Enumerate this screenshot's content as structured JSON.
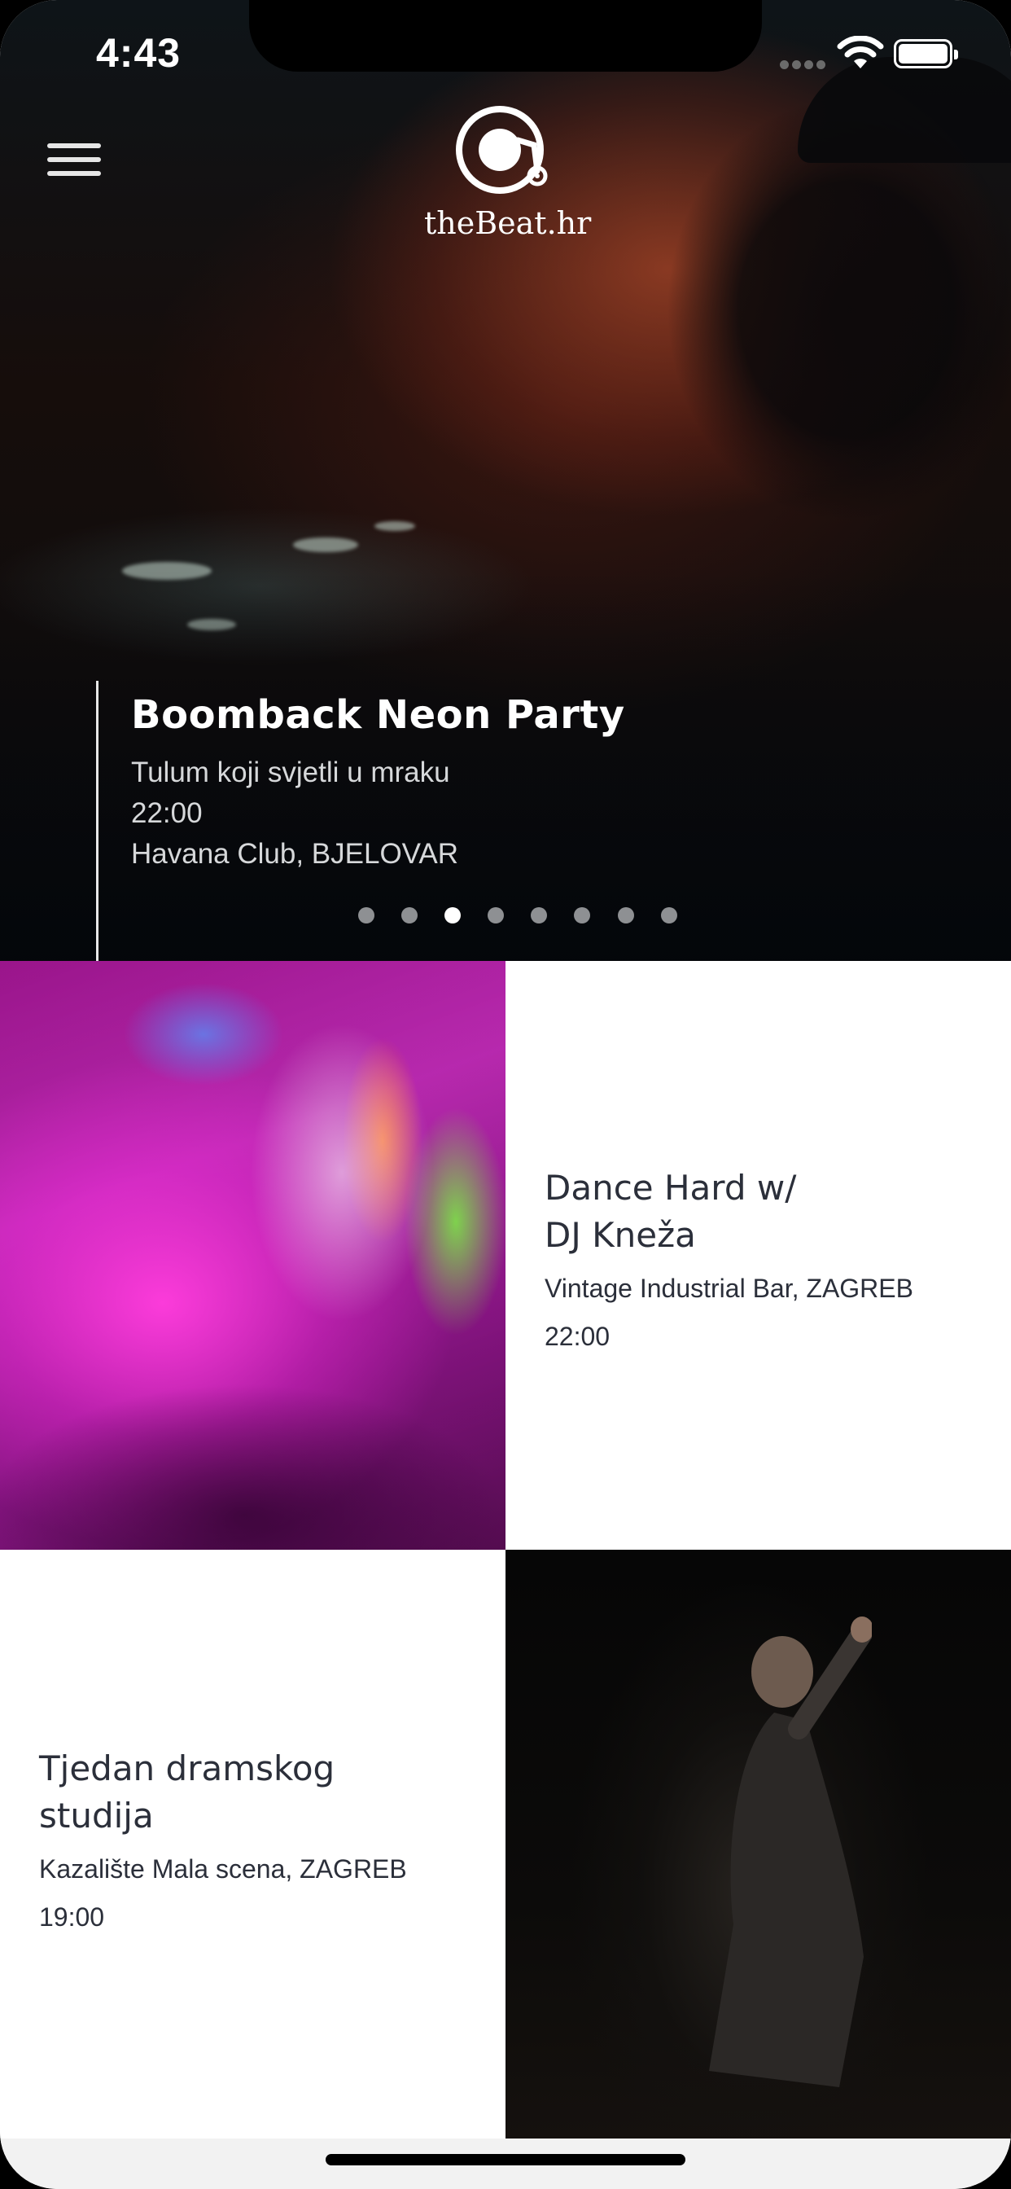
{
  "status_bar": {
    "time": "4:43"
  },
  "header": {
    "logo_text": "theBeat.hr"
  },
  "hero": {
    "title": "Boomback Neon Party",
    "subtitle": "Tulum koji svjetli u mraku",
    "time": "22:00",
    "venue": "Havana Club, BJELOVAR",
    "carousel": {
      "count": 8,
      "active_index": 2
    }
  },
  "events": [
    {
      "title_line1": "Dance Hard w/",
      "title_line2": "DJ Kneža",
      "venue": "Vintage Industrial Bar, ZAGREB",
      "time": "22:00"
    },
    {
      "title_line1": "Tjedan dramskog",
      "title_line2": "studija",
      "venue": "Kazalište Mala scena, ZAGREB",
      "time": "19:00"
    }
  ],
  "icons": {
    "menu": "hamburger-menu-icon",
    "logo": "thebeat-logo-icon",
    "wifi": "wifi-icon",
    "battery": "battery-icon",
    "signal": "signal-icon"
  },
  "colors": {
    "card_text": "#2b2f3a",
    "hero_text": "#ffffff",
    "dot_inactive": "#8e9093"
  }
}
